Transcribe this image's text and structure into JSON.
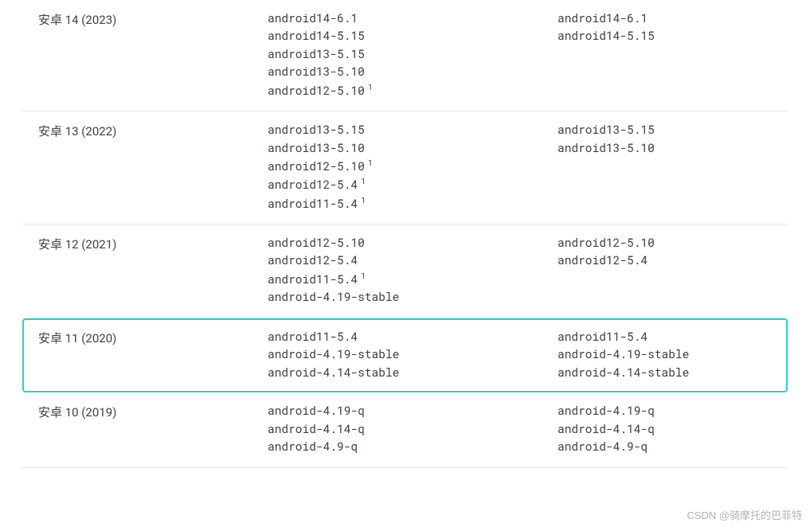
{
  "rows": [
    {
      "name": "安卓 14 (2023)",
      "highlighted": false,
      "col2": [
        {
          "text": "android14-6.1",
          "note": ""
        },
        {
          "text": "android14-5.15",
          "note": ""
        },
        {
          "text": "android13-5.15",
          "note": ""
        },
        {
          "text": "android13-5.10",
          "note": ""
        },
        {
          "text": "android12-5.10",
          "note": "1"
        }
      ],
      "col3": [
        {
          "text": "android14-6.1",
          "note": ""
        },
        {
          "text": "android14-5.15",
          "note": ""
        }
      ]
    },
    {
      "name": "安卓 13 (2022)",
      "highlighted": false,
      "col2": [
        {
          "text": "android13-5.15",
          "note": ""
        },
        {
          "text": "android13-5.10",
          "note": ""
        },
        {
          "text": "android12-5.10",
          "note": "1"
        },
        {
          "text": "android12-5.4",
          "note": "1"
        },
        {
          "text": "android11-5.4",
          "note": "1"
        }
      ],
      "col3": [
        {
          "text": "android13-5.15",
          "note": ""
        },
        {
          "text": "android13-5.10",
          "note": ""
        }
      ]
    },
    {
      "name": "安卓 12 (2021)",
      "highlighted": false,
      "col2": [
        {
          "text": "android12-5.10",
          "note": ""
        },
        {
          "text": "android12-5.4",
          "note": ""
        },
        {
          "text": "android11-5.4",
          "note": "1"
        },
        {
          "text": "android-4.19-stable",
          "note": ""
        }
      ],
      "col3": [
        {
          "text": "android12-5.10",
          "note": ""
        },
        {
          "text": "android12-5.4",
          "note": ""
        }
      ]
    },
    {
      "name": "安卓 11 (2020)",
      "highlighted": true,
      "col2": [
        {
          "text": "android11-5.4",
          "note": ""
        },
        {
          "text": "android-4.19-stable",
          "note": ""
        },
        {
          "text": "android-4.14-stable",
          "note": ""
        }
      ],
      "col3": [
        {
          "text": "android11-5.4",
          "note": ""
        },
        {
          "text": "android-4.19-stable",
          "note": ""
        },
        {
          "text": "android-4.14-stable",
          "note": ""
        }
      ]
    },
    {
      "name": "安卓 10 (2019)",
      "highlighted": false,
      "col2": [
        {
          "text": "android-4.19-q",
          "note": ""
        },
        {
          "text": "android-4.14-q",
          "note": ""
        },
        {
          "text": "android-4.9-q",
          "note": ""
        }
      ],
      "col3": [
        {
          "text": "android-4.19-q",
          "note": ""
        },
        {
          "text": "android-4.14-q",
          "note": ""
        },
        {
          "text": "android-4.9-q",
          "note": ""
        }
      ]
    }
  ],
  "watermark": "CSDN @骑摩托的巴菲特"
}
